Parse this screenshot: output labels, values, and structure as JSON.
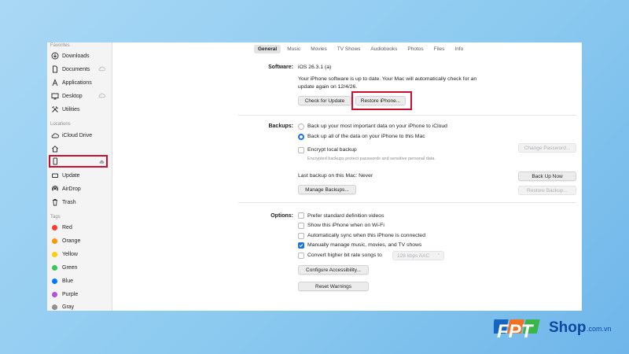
{
  "sidebar": {
    "favorites_header": "Favorites",
    "favorites": [
      {
        "label": "Downloads",
        "icon": "download-icon"
      },
      {
        "label": "Documents",
        "icon": "document-icon"
      },
      {
        "label": "Applications",
        "icon": "applications-icon"
      },
      {
        "label": "Desktop",
        "icon": "desktop-icon"
      },
      {
        "label": "Utilities",
        "icon": "utilities-icon"
      }
    ],
    "locations_header": "Locations",
    "locations": [
      {
        "label": "iCloud Drive",
        "icon": "icloud-icon"
      },
      {
        "label": "",
        "icon": "home-icon"
      },
      {
        "label": "",
        "icon": "iphone-icon",
        "eject_icon": "eject-icon"
      },
      {
        "label": "Update",
        "icon": "disk-icon"
      },
      {
        "label": "AirDrop",
        "icon": "airdrop-icon"
      },
      {
        "label": "Trash",
        "icon": "trash-icon"
      }
    ],
    "tags_header": "Tags",
    "tags": [
      {
        "label": "Red",
        "color": "#ff3b30"
      },
      {
        "label": "Orange",
        "color": "#ff9500"
      },
      {
        "label": "Yellow",
        "color": "#ffcc00"
      },
      {
        "label": "Green",
        "color": "#34c759"
      },
      {
        "label": "Blue",
        "color": "#007aff"
      },
      {
        "label": "Purple",
        "color": "#af52de"
      },
      {
        "label": "Gray",
        "color": "#8e8e93"
      }
    ]
  },
  "tabs": [
    "General",
    "Music",
    "Movies",
    "TV Shows",
    "Audiobooks",
    "Photos",
    "Files",
    "Info"
  ],
  "active_tab": "General",
  "software": {
    "label": "Software:",
    "version": "iOS 26.3.1 (a)",
    "status_line1": "Your iPhone software is up to date. Your Mac will automatically check for an",
    "status_line2": "update again on 12/4/26.",
    "check_button": "Check for Update",
    "restore_button": "Restore iPhone..."
  },
  "backups": {
    "label": "Backups:",
    "option_icloud": "Back up your most important data on your iPhone to iCloud",
    "option_mac": "Back up all of the data on your iPhone to this Mac",
    "selected": "mac",
    "encrypt_label": "Encrypt local backup",
    "encrypt_checked": false,
    "encrypt_note": "Encrypted backups protect passwords and sensitive personal data.",
    "change_password_button": "Change Password...",
    "last_backup": "Last backup on this Mac: Never",
    "back_up_now_button": "Back Up Now",
    "manage_button": "Manage Backups...",
    "restore_backup_button": "Restore Backup..."
  },
  "options": {
    "label": "Options:",
    "items": [
      {
        "label": "Prefer standard definition videos",
        "checked": false
      },
      {
        "label": "Show this iPhone when on Wi-Fi",
        "checked": false
      },
      {
        "label": "Automatically sync when this iPhone is connected",
        "checked": false
      },
      {
        "label": "Manually manage music, movies, and TV shows",
        "checked": true
      },
      {
        "label": "Convert higher bit rate songs to",
        "checked": false
      }
    ],
    "bitrate_value": "128 kbps AAC",
    "accessibility_button": "Configure Accessibility...",
    "reset_button": "Reset Warnings"
  },
  "brand": {
    "fpt": "FPT",
    "shop": "Shop",
    "domain": ".com.vn"
  },
  "colors": {
    "accent": "#1a73e8",
    "highlight": "#c8102e",
    "brand_blue": "#1565c0",
    "brand_orange": "#f37021",
    "brand_green": "#3ab54a"
  }
}
